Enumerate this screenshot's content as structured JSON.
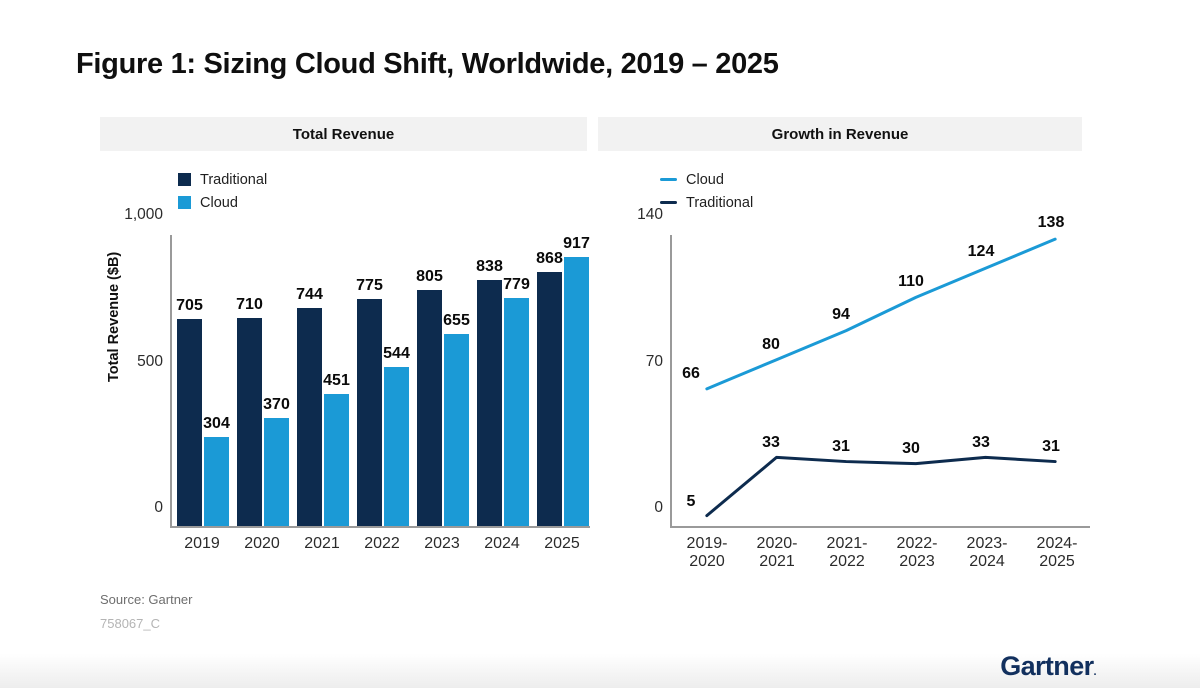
{
  "title": "Figure 1: Sizing Cloud Shift, Worldwide, 2019 – 2025",
  "panels": {
    "left_header": "Total Revenue",
    "right_header": "Growth in Revenue"
  },
  "footer": {
    "source": "Source: Gartner",
    "figure_id": "758067_C",
    "logo": "Gartner",
    "logo_mark": "."
  },
  "colors": {
    "traditional": "#0d2b4e",
    "cloud": "#1b9ad6",
    "header_bg": "#f2f2f2",
    "axis": "#9a9a9a",
    "logo": "#12305e"
  },
  "chart_data": [
    {
      "type": "bar",
      "title": "Total Revenue",
      "xlabel": "",
      "ylabel": "Total Revenue ($B)",
      "categories": [
        "2019",
        "2020",
        "2021",
        "2022",
        "2023",
        "2024",
        "2025"
      ],
      "ylim": [
        0,
        1000
      ],
      "yticks": [
        0,
        500,
        1000
      ],
      "ytick_labels": [
        "0",
        "500",
        "1,000"
      ],
      "grid": false,
      "legend_position": "top-left",
      "series": [
        {
          "name": "Traditional",
          "color": "#0d2b4e",
          "values": [
            705,
            710,
            744,
            775,
            805,
            838,
            868
          ]
        },
        {
          "name": "Cloud",
          "color": "#1b9ad6",
          "values": [
            304,
            370,
            451,
            544,
            655,
            779,
            917
          ]
        }
      ]
    },
    {
      "type": "line",
      "title": "Growth in Revenue",
      "xlabel": "",
      "ylabel": "",
      "categories": [
        "2019-\n2020",
        "2020-\n2021",
        "2021-\n2022",
        "2022-\n2023",
        "2023-\n2024",
        "2024-\n2025"
      ],
      "ylim": [
        0,
        140
      ],
      "yticks": [
        0,
        70,
        140
      ],
      "ytick_labels": [
        "0",
        "70",
        "140"
      ],
      "grid": false,
      "legend_position": "top-left",
      "series": [
        {
          "name": "Cloud",
          "color": "#1b9ad6",
          "values": [
            66,
            80,
            94,
            110,
            124,
            138
          ]
        },
        {
          "name": "Traditional",
          "color": "#0d2b4e",
          "values": [
            5,
            33,
            31,
            30,
            33,
            31
          ]
        }
      ]
    }
  ]
}
